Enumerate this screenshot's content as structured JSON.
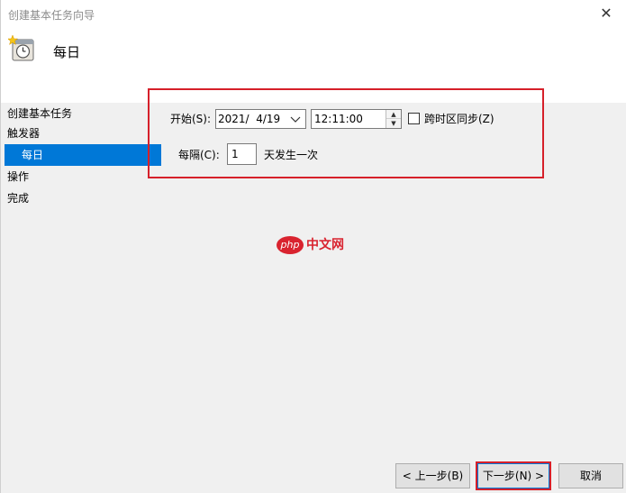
{
  "window": {
    "title": "创建基本任务向导",
    "close_glyph": "✕"
  },
  "header": {
    "icon": "calendar-clock-icon",
    "title": "每日"
  },
  "sidebar": {
    "items": [
      {
        "label": "创建基本任务",
        "selected": false
      },
      {
        "label": "触发器",
        "selected": false
      },
      {
        "label": "每日",
        "selected": true
      },
      {
        "label": "操作",
        "selected": false
      },
      {
        "label": "完成",
        "selected": false
      }
    ]
  },
  "form": {
    "start_label": "开始(S):",
    "start_date": "2021/  4/19",
    "start_time": "12:11:00",
    "sync_timezone_label": "跨时区同步(Z)",
    "sync_timezone_checked": false,
    "interval_label": "每隔(C):",
    "interval_value": "1",
    "interval_suffix": "天发生一次"
  },
  "watermark": {
    "badge": "php",
    "text": "中文网"
  },
  "buttons": {
    "back": "< 上一步(B)",
    "next": "下一步(N) >",
    "cancel": "取消"
  },
  "colors": {
    "accent": "#0078d7",
    "highlight": "#d6202a"
  }
}
